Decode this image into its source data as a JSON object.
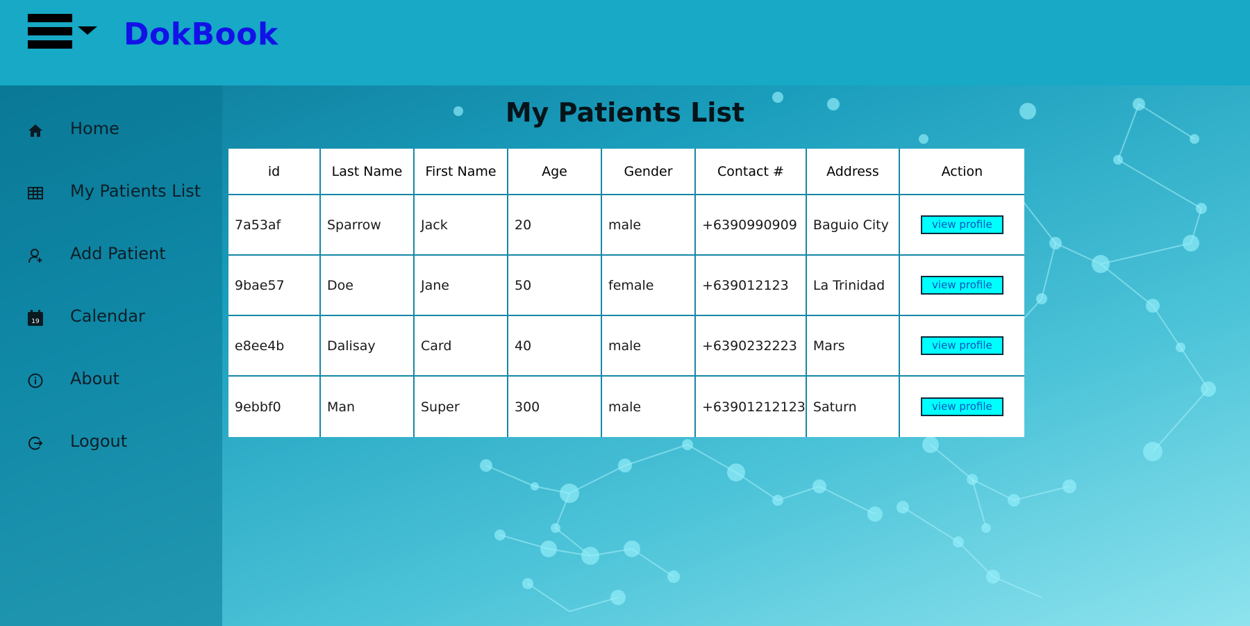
{
  "header": {
    "brand": "DokBook"
  },
  "sidebar": {
    "items": [
      {
        "label": "Home",
        "icon": "home-icon"
      },
      {
        "label": "My Patients List",
        "icon": "table-icon"
      },
      {
        "label": "Add Patient",
        "icon": "add-user-icon"
      },
      {
        "label": "Calendar",
        "icon": "calendar-icon",
        "icon_text": "19"
      },
      {
        "label": "About",
        "icon": "info-icon"
      },
      {
        "label": "Logout",
        "icon": "logout-icon"
      }
    ]
  },
  "main": {
    "title": "My Patients List",
    "table": {
      "headers": [
        "id",
        "Last Name",
        "First Name",
        "Age",
        "Gender",
        "Contact #",
        "Address",
        "Action"
      ],
      "rows": [
        {
          "id": "7a53af",
          "last_name": "Sparrow",
          "first_name": "Jack",
          "age": "20",
          "gender": "male",
          "contact": "+6390990909",
          "address": "Baguio City",
          "action": "view profile"
        },
        {
          "id": "9bae57",
          "last_name": "Doe",
          "first_name": "Jane",
          "age": "50",
          "gender": "female",
          "contact": "+639012123",
          "address": "La Trinidad",
          "action": "view profile"
        },
        {
          "id": "e8ee4b",
          "last_name": "Dalisay",
          "first_name": "Card",
          "age": "40",
          "gender": "male",
          "contact": "+6390232223",
          "address": "Mars",
          "action": "view profile"
        },
        {
          "id": "9ebbf0",
          "last_name": "Man",
          "first_name": "Super",
          "age": "300",
          "gender": "male",
          "contact": "+63901212123",
          "address": "Saturn",
          "action": "view profile"
        }
      ]
    }
  },
  "colors": {
    "header_bg": "#17a9c5",
    "brand": "#1212e8",
    "button_bg": "#00ffff",
    "button_text": "#0a55b8"
  }
}
